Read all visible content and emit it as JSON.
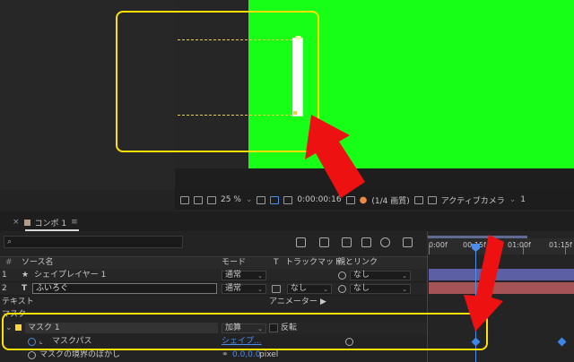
{
  "viewer": {
    "zoom": "25 %",
    "timecode": "0:00:00:16",
    "resolution": "(1/4 画質)",
    "camera": "アクティブカメラ",
    "views": "1"
  },
  "timeline": {
    "tab_label": "コンポ 1",
    "tab_color": "#b49b86",
    "search_placeholder": "",
    "columns": {
      "source_name": "ソース名",
      "mode": "モード",
      "t": "T",
      "track_matte": "トラックマット",
      "parent_link": "親とリンク"
    },
    "ruler": [
      "0:00f",
      "00:15f",
      "01:00f",
      "01:15f"
    ],
    "layers": [
      {
        "index": "1",
        "icon": "★",
        "name": "シェイプレイヤー 1",
        "mode": "通常",
        "matte": "",
        "parent": "なし",
        "bar_color": "#5c5fa3"
      },
      {
        "index": "2",
        "icon": "T",
        "name": "ふいろぐ",
        "mode": "通常",
        "matte": "なし",
        "parent": "なし",
        "bar_color": "#a65357"
      }
    ],
    "text_group": "テキスト",
    "animator_label": "アニメーター :",
    "mask_group": "マスク",
    "mask": {
      "name": "マスク 1",
      "color": "#ffd43b",
      "mode": "加算",
      "invert_label": "反転",
      "path_label": "マスクパス",
      "path_value": "シェイプ...",
      "feather_label": "マスクの境界のぼかし",
      "feather_value": "0.0,0.0",
      "feather_unit": "pixel"
    }
  },
  "colors": {
    "canvas_green": "#17ff17",
    "highlight_yellow": "#ffe000",
    "arrow_red": "#ee1111",
    "accent_blue": "#4d8de8"
  }
}
